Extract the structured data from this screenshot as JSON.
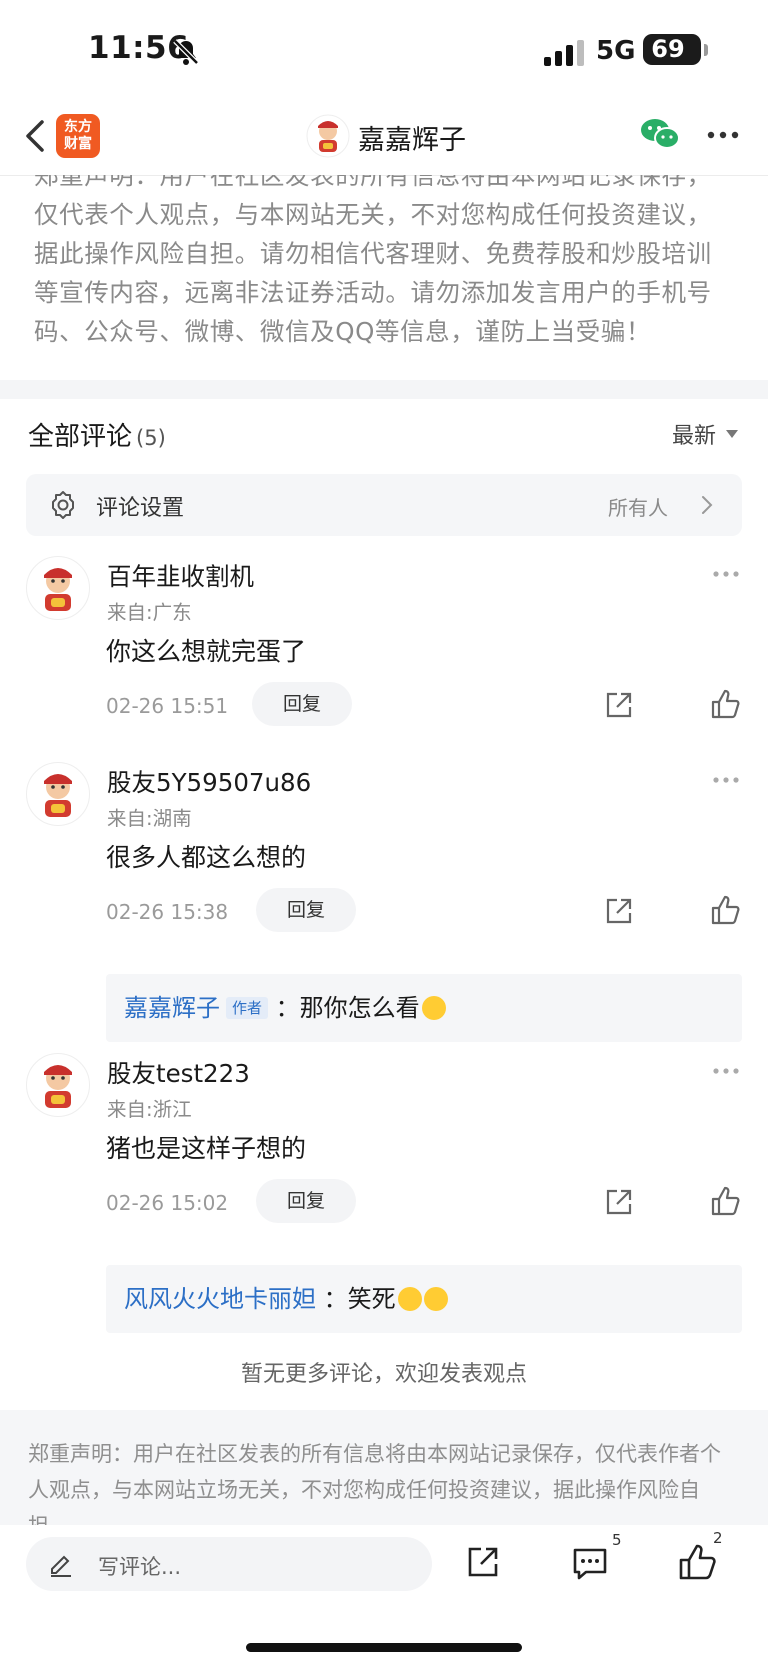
{
  "status_bar": {
    "time": "11:56",
    "network": "5G",
    "battery": "69"
  },
  "nav": {
    "logo_line1": "东方",
    "logo_line2": "财富",
    "title": "嘉嘉辉子"
  },
  "disclaimer_top": "郑重声明：用户在社区发表的所有信息将由本网站记录保存，仅代表个人观点，与本网站无关，不对您构成任何投资建议，据此操作风险自担。请勿相信代客理财、免费荐股和炒股培训等宣传内容，远离非法证券活动。请勿添加发言用户的手机号码、公众号、微博、微信及QQ等信息，谨防上当受骗！",
  "comments_header": {
    "title": "全部评论",
    "count": "(5)",
    "sort": "最新"
  },
  "settings": {
    "label": "评论设置",
    "value": "所有人"
  },
  "comments": [
    {
      "name": "百年韭收割机",
      "location": "来自:广东",
      "text": "你这么想就完蛋了",
      "time": "02-26 15:51",
      "reply_label": "回复"
    },
    {
      "name": "股友5Y59507u86",
      "location": "来自:湖南",
      "text": "很多人都这么想的",
      "time": "02-26 15:38",
      "reply_label": "回复",
      "sub_reply": {
        "author": "嘉嘉辉子",
        "badge": "作者",
        "text": "：那你怎么看"
      }
    },
    {
      "name": "股友test223",
      "location": "来自:浙江",
      "text": "猪也是这样子想的",
      "time": "02-26 15:02",
      "reply_label": "回复",
      "sub_reply": {
        "author": "风风火火地卡丽妲",
        "text": "：笑死"
      }
    }
  ],
  "no_more": "暂无更多评论，欢迎发表观点",
  "footer_disclaimer": "郑重声明：用户在社区发表的所有信息将由本网站记录保存，仅代表作者个人观点，与本网站立场无关，不对您构成任何投资建议，据此操作风险自担。",
  "bottom_bar": {
    "placeholder": "写评论...",
    "comment_count": "5",
    "like_count": "2"
  },
  "colors": {
    "accent_blue": "#2c6fc6",
    "brand_orange": "#f05a22",
    "wechat_green": "#2aae67"
  }
}
